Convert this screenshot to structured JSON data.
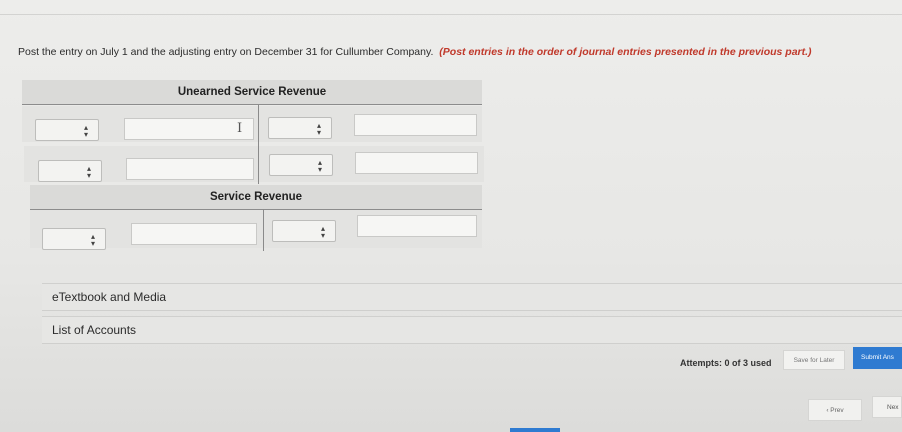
{
  "instructions": {
    "main": "Post the entry on July 1 and the adjusting entry on December 31 for Cullumber Company.",
    "note": "(Post entries in the order of journal entries presented in the previous part.)"
  },
  "accounts": [
    {
      "title": "Unearned Service Revenue"
    },
    {
      "title": "Service Revenue"
    }
  ],
  "links": {
    "etextbook": "eTextbook and Media",
    "list_of_accounts": "List of Accounts"
  },
  "footer": {
    "attempts": "Attempts: 0 of 3 used",
    "save_label": "Save for Later",
    "submit_label": "Submit Ans",
    "prev_label": "‹ Prev",
    "next_label": "Nex"
  },
  "icons": {
    "select_arrow": "updown-arrow-icon",
    "text_cursor": "i-beam-cursor-icon"
  },
  "colors": {
    "note_red": "#c0392b",
    "primary_blue": "#2f7bd1"
  }
}
